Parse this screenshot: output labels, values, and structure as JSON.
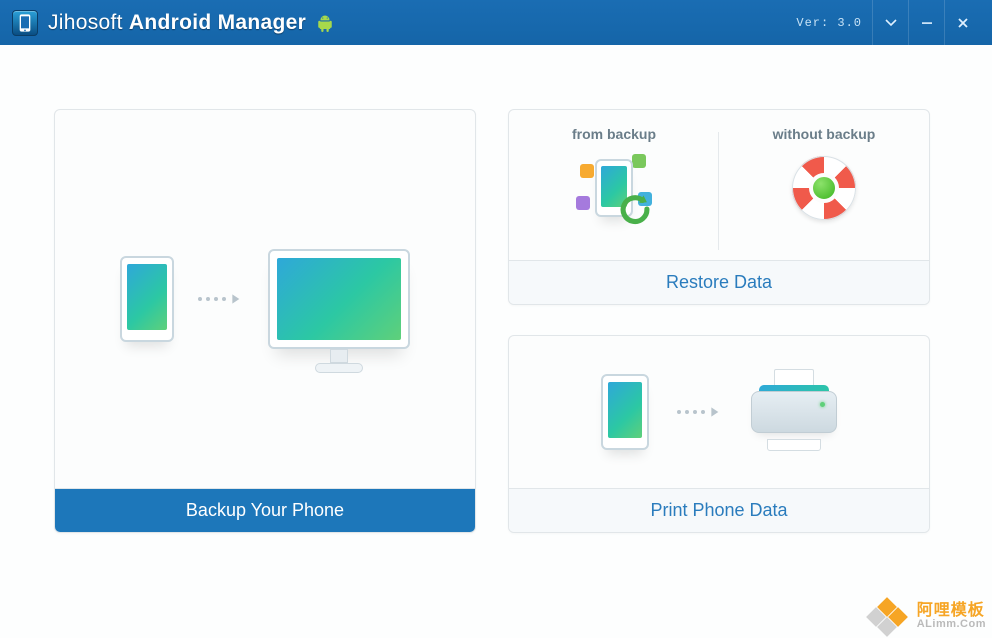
{
  "titlebar": {
    "brand_light": "Jihosoft ",
    "brand_bold": "Android Manager",
    "version": "Ver: 3.0"
  },
  "cards": {
    "backup": {
      "label": "Backup Your Phone"
    },
    "restore": {
      "label": "Restore Data",
      "from_backup": "from backup",
      "without_backup": "without backup"
    },
    "print": {
      "label": "Print Phone Data"
    }
  },
  "watermark": {
    "cn": "阿哩模板",
    "en": "ALimm.Com"
  }
}
